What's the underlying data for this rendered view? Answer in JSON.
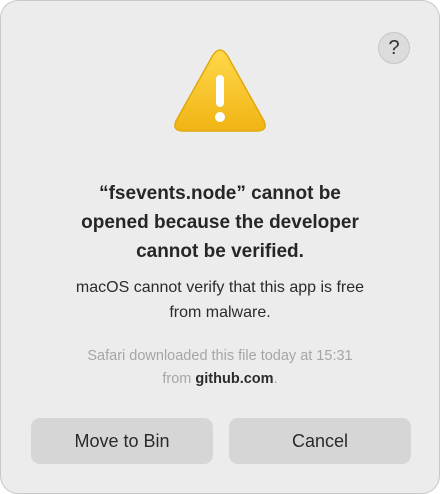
{
  "dialog": {
    "help_label": "?",
    "icon": "warning-triangle-icon",
    "title_lines": [
      "“fsevents.node” cannot be",
      "opened because the developer",
      "cannot be verified."
    ],
    "message_lines": [
      "macOS cannot verify that this app is free",
      "from malware."
    ],
    "source_line1": "Safari downloaded this file today at 15:31",
    "source_prefix": "from",
    "source_site": "github.com",
    "source_suffix": ".",
    "buttons": {
      "move_to_bin": "Move to Bin",
      "cancel": "Cancel"
    }
  },
  "colors": {
    "dialog_background": "#ececec",
    "button_background": "#d6d6d6",
    "warning_yellow": "#f5c323",
    "muted_text": "#a6a6a6"
  }
}
